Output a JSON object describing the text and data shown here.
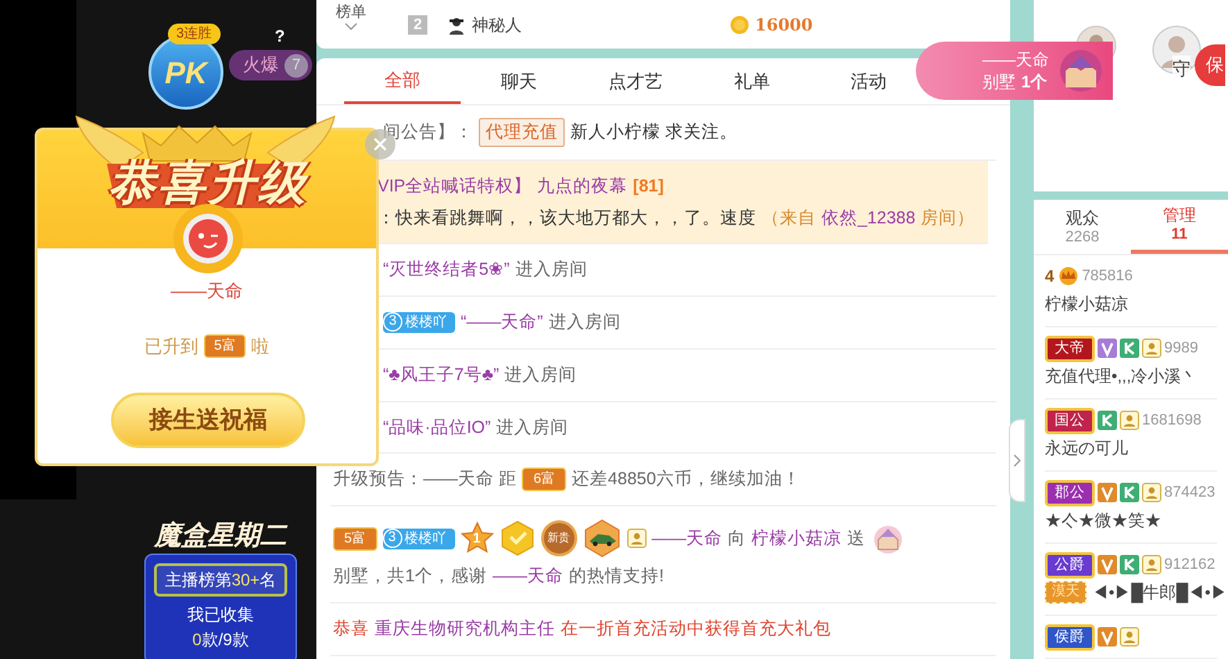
{
  "rank_strip": {
    "label": "榜单",
    "row": {
      "rank": "2",
      "name": "神秘人",
      "coins": "16000"
    }
  },
  "chat_tabs": [
    {
      "label": "全部",
      "selected": true
    },
    {
      "label": "聊天",
      "selected": false
    },
    {
      "label": "点才艺",
      "selected": false
    },
    {
      "label": "礼单",
      "selected": false
    },
    {
      "label": "活动",
      "selected": false
    }
  ],
  "chat": [
    {
      "cut": true,
      "highlight": false,
      "segments": [
        {
          "kind": "plain",
          "text": "间公告】："
        },
        {
          "kind": "tag",
          "text": "代理充值"
        },
        {
          "kind": "dark",
          "text": "新人小柠檬 求关注。"
        }
      ]
    },
    {
      "cut": true,
      "highlight": true,
      "segments": [
        {
          "kind": "name",
          "text": "VIP全站喊话特权】"
        },
        {
          "kind": "name",
          "text": "九点的夜幕"
        },
        {
          "kind": "level",
          "text": "[81]"
        },
        {
          "kind": "dark",
          "text": "：快来看跳舞啊，，该大地万都大，，了。速度"
        },
        {
          "kind": "source",
          "text": "（来自"
        },
        {
          "kind": "name",
          "text": "依然_12388"
        },
        {
          "kind": "source",
          "text": "房间）"
        }
      ]
    },
    {
      "cut": true,
      "highlight": false,
      "segments": [
        {
          "kind": "name",
          "text": "“灭世终结者5❀”"
        },
        {
          "kind": "plain",
          "text": "进入房间"
        }
      ]
    },
    {
      "cut": true,
      "highlight": false,
      "segments": [
        {
          "kind": "fan",
          "num": "3",
          "text": "楼楼吖"
        },
        {
          "kind": "name",
          "text": "“——天命”"
        },
        {
          "kind": "plain",
          "text": "进入房间"
        }
      ]
    },
    {
      "cut": true,
      "highlight": false,
      "segments": [
        {
          "kind": "name",
          "text": "“♣风王子7号♣”"
        },
        {
          "kind": "plain",
          "text": "进入房间"
        }
      ]
    },
    {
      "cut": true,
      "highlight": false,
      "segments": [
        {
          "kind": "name",
          "text": "“品味·品位IO”"
        },
        {
          "kind": "plain",
          "text": "进入房间"
        }
      ]
    },
    {
      "cut": false,
      "highlight": false,
      "segments": [
        {
          "kind": "plain",
          "text": "升级预告：——天命 距"
        },
        {
          "kind": "wealth",
          "text": "6富"
        },
        {
          "kind": "plain",
          "text": "还差48850六币，继续加油！"
        }
      ]
    },
    {
      "cut": false,
      "highlight": false,
      "segments": [
        {
          "kind": "wealth",
          "text": "5富"
        },
        {
          "kind": "fan",
          "num": "3",
          "text": "楼楼吖"
        },
        {
          "kind": "star-medal",
          "text": "1"
        },
        {
          "kind": "hex-medal"
        },
        {
          "kind": "round-medal",
          "text": "新贵"
        },
        {
          "kind": "car-medal"
        },
        {
          "kind": "user-icon"
        },
        {
          "kind": "name",
          "text": "——天命"
        },
        {
          "kind": "plain",
          "text": "向"
        },
        {
          "kind": "name",
          "text": "柠檬小菇凉"
        },
        {
          "kind": "plain",
          "text": "送"
        },
        {
          "kind": "gift-icon"
        },
        {
          "kind": "plain",
          "text": "别墅，共1个，感谢"
        },
        {
          "kind": "name",
          "text": "——天命"
        },
        {
          "kind": "plain",
          "text": "的热情支持!"
        }
      ]
    },
    {
      "cut": false,
      "highlight": false,
      "segments": [
        {
          "kind": "red",
          "text": "恭喜"
        },
        {
          "kind": "name",
          "text": "重庆生物研究机构主任"
        },
        {
          "kind": "red",
          "text": "在一折首充活动中获得首充大礼包"
        }
      ]
    }
  ],
  "popup": {
    "streak": "3连胜",
    "pk": "PK",
    "hot": "火爆",
    "hot_count": "7",
    "help": "?",
    "title": "恭喜升级",
    "user": "——天命",
    "upgrade_before": "已升到",
    "upgrade_level": "5富",
    "upgrade_after": "啦",
    "button": "接生送祝福"
  },
  "toast": {
    "user": "——天命",
    "gift": "别墅",
    "count": "1个"
  },
  "guard": {
    "label": "守",
    "badge": "保"
  },
  "promo": {
    "title": "魔盒星期二",
    "rank_before": "主播榜第",
    "rank_num": "30+",
    "rank_after": "名",
    "collected": "我已收集",
    "count_have": "0",
    "count_total": "款/9款"
  },
  "audience_tabs": [
    {
      "label": "观众",
      "count": "2268",
      "selected": false
    },
    {
      "label": "管理",
      "count": "11",
      "selected": true
    }
  ],
  "members": [
    {
      "badges": [
        {
          "kind": "crown",
          "text": "4"
        }
      ],
      "id": "785816",
      "name": "柠檬小菇凉"
    },
    {
      "badges": [
        {
          "kind": "title",
          "text": "大帝",
          "color": "#b3171d"
        },
        {
          "kind": "v",
          "color": "#a87bd8"
        },
        {
          "kind": "k"
        },
        {
          "kind": "user"
        }
      ],
      "id": "9989",
      "name": "充值代理•,,,冷小溪丶"
    },
    {
      "badges": [
        {
          "kind": "title",
          "text": "国公",
          "color": "#c0234b"
        },
        {
          "kind": "k"
        },
        {
          "kind": "user"
        }
      ],
      "id": "1681698",
      "name": "永远の可儿"
    },
    {
      "badges": [
        {
          "kind": "title",
          "text": "郡公",
          "color": "#9b2fb0"
        },
        {
          "kind": "v",
          "color": "#e08a2b"
        },
        {
          "kind": "k"
        },
        {
          "kind": "user"
        }
      ],
      "id": "874423",
      "name": "★亽★微★笑★"
    },
    {
      "badges": [
        {
          "kind": "title",
          "text": "公爵",
          "color": "#6a3bd0"
        },
        {
          "kind": "v",
          "color": "#e08a2b"
        },
        {
          "kind": "k"
        },
        {
          "kind": "user"
        }
      ],
      "id": "912162",
      "tag": "漠天",
      "name": "◀•▶█牛郎█◀•▶"
    },
    {
      "badges": [
        {
          "kind": "title",
          "text": "侯爵",
          "color": "#2f56c8"
        },
        {
          "kind": "v",
          "color": "#e08a2b"
        },
        {
          "kind": "user"
        }
      ]
    }
  ]
}
